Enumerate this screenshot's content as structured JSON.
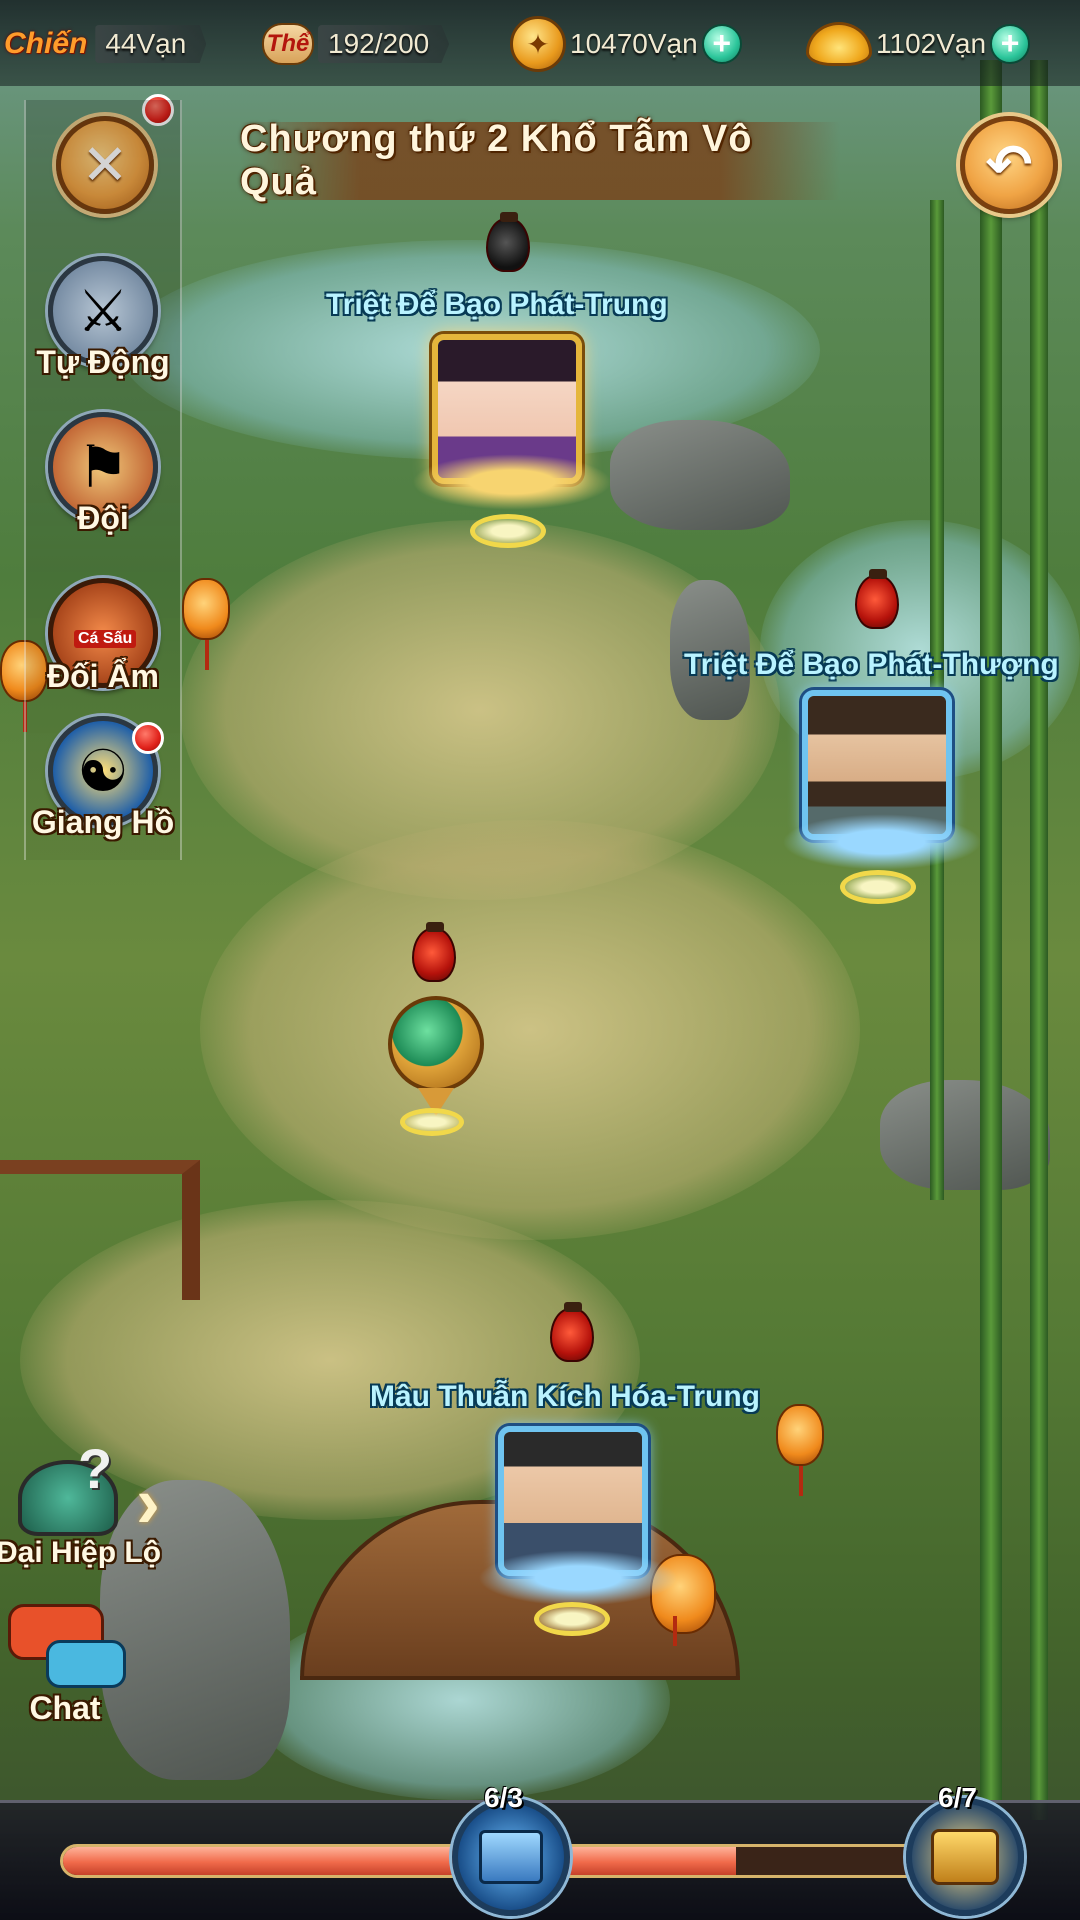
{
  "resources": {
    "chien": {
      "icon_text": "Chiến",
      "value": "44Vạn"
    },
    "the": {
      "icon_text": "Thể",
      "value": "192/200"
    },
    "coins": {
      "value": "10470Vạn"
    },
    "ingots": {
      "value": "1102Vạn"
    }
  },
  "chapter_title": "Chương thứ 2 Khổ Tẫm Vô Quả",
  "side_menu": [
    {
      "label": "Tự Động",
      "icon": "auto-sword-icon"
    },
    {
      "label": "Đội",
      "icon": "team-banner-icon"
    },
    {
      "label": "Đối Ẩm",
      "badge": "Cá Sấu",
      "icon": "wine-jar-icon"
    },
    {
      "label": "Giang Hồ",
      "icon": "jianghu-scroll-icon"
    }
  ],
  "lower_menu": [
    {
      "label": "Đại Hiệp Lộ",
      "icon": "hero-road-icon"
    },
    {
      "label": "Chat",
      "icon": "chat-bubble-icon"
    }
  ],
  "stages": [
    {
      "name": "Triệt Để Bạo Phát-Trung",
      "frame": "gold"
    },
    {
      "name": "Triệt Để Bạo Phát-Thượng",
      "frame": "blue"
    },
    {
      "name": "Mâu Thuẫn Kích Hóa-Trung",
      "frame": "blue"
    }
  ],
  "progress": {
    "chest_1_count": "6/3",
    "chest_2_count": "6/7",
    "fill_fraction": 0.77
  }
}
